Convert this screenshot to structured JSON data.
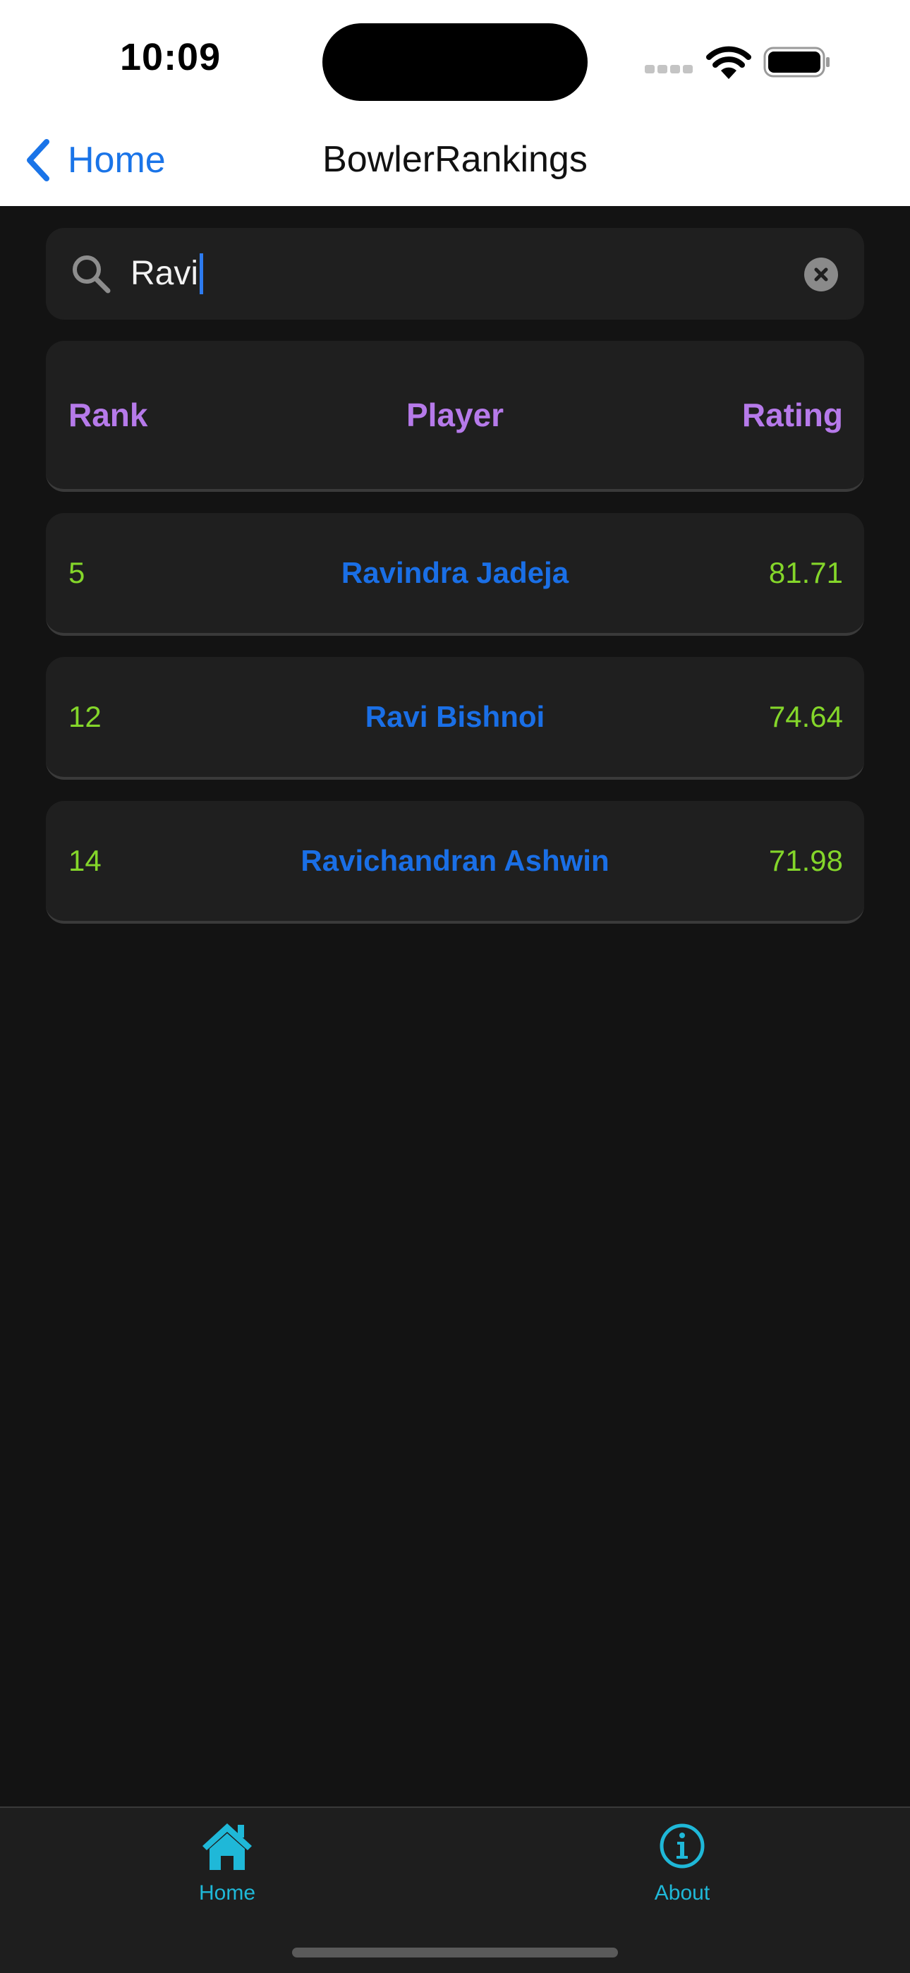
{
  "status_bar": {
    "time": "10:09"
  },
  "nav": {
    "back_label": "Home",
    "title": "BowlerRankings"
  },
  "search": {
    "value": "Ravi"
  },
  "table": {
    "headers": {
      "rank": "Rank",
      "player": "Player",
      "rating": "Rating"
    },
    "rows": [
      {
        "rank": "5",
        "player": "Ravindra Jadeja",
        "rating": "81.71"
      },
      {
        "rank": "12",
        "player": "Ravi Bishnoi",
        "rating": "74.64"
      },
      {
        "rank": "14",
        "player": "Ravichandran Ashwin",
        "rating": "71.98"
      }
    ]
  },
  "tabbar": {
    "items": [
      {
        "label": "Home",
        "icon": "house-icon"
      },
      {
        "label": "About",
        "icon": "info-icon"
      }
    ]
  },
  "colors": {
    "accent_blue": "#1a74e8",
    "header_purple": "#b67aea",
    "value_green": "#84d62a",
    "tab_cyan": "#1fb8d8",
    "background": "#131313",
    "card": "#1f1f1f"
  }
}
